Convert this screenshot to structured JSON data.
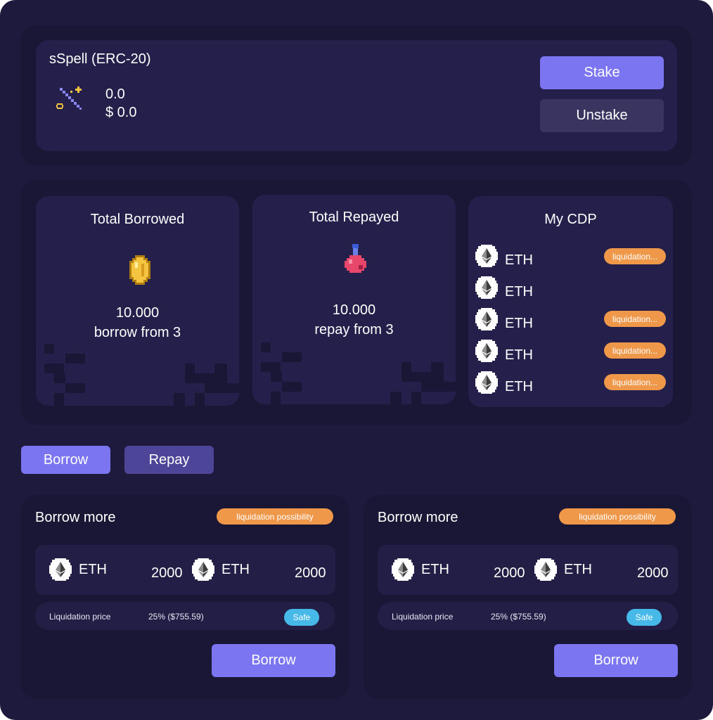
{
  "stake": {
    "title": "sSpell (ERC-20)",
    "amount": "0.0",
    "usd": "$ 0.0",
    "stake_label": "Stake",
    "unstake_label": "Unstake"
  },
  "stats": {
    "borrowed": {
      "title": "Total Borrowed",
      "value": "10.000",
      "sub": "borrow from 3"
    },
    "repaid": {
      "title": "Total Repayed",
      "value": "10.000",
      "sub": "repay from 3"
    },
    "cdp": {
      "title": "My CDP",
      "items": [
        {
          "token": "ETH",
          "badge": "liquidation..."
        },
        {
          "token": "ETH",
          "badge": ""
        },
        {
          "token": "ETH",
          "badge": "liquidation..."
        },
        {
          "token": "ETH",
          "badge": "liquidation..."
        },
        {
          "token": "ETH",
          "badge": "liquidation..."
        }
      ]
    }
  },
  "tabs": {
    "borrow": "Borrow",
    "repay": "Repay"
  },
  "forms": [
    {
      "title": "Borrow more",
      "badge": "liquidation possibility",
      "token_a": "ETH",
      "amount_a": "2000",
      "token_b": "ETH",
      "amount_b": "2000",
      "liq_label": "Liquidation price",
      "liq_value": "25% ($755.59)",
      "status": "Safe",
      "button": "Borrow"
    },
    {
      "title": "Borrow more",
      "badge": "liquidation possibility",
      "token_a": "ETH",
      "amount_a": "2000",
      "token_b": "ETH",
      "amount_b": "2000",
      "liq_label": "Liquidation price",
      "liq_value": "25% ($755.59)",
      "status": "Safe",
      "button": "Borrow"
    }
  ],
  "colors": {
    "background": "#1e1a3e",
    "card": "#241f4b",
    "accent": "#7b75f2",
    "warning": "#f0984a",
    "safe": "#46b9e8"
  },
  "icons": [
    "magic-wand-icon",
    "gold-coin-icon",
    "potion-icon",
    "eth-icon"
  ]
}
